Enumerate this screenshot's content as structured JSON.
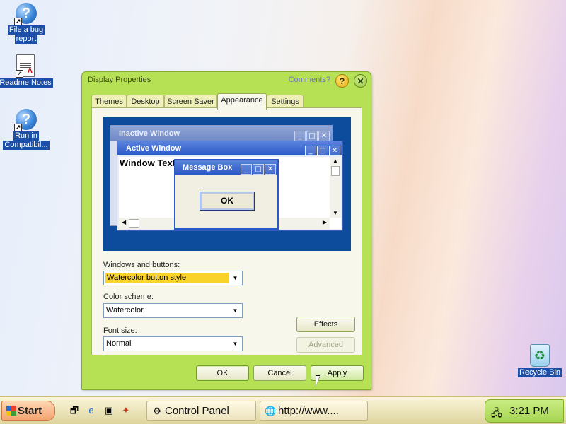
{
  "desktop": {
    "icons": [
      {
        "label_line1": "File a bug",
        "label_line2": "report",
        "icon": "help-icon"
      },
      {
        "label": "Readme Notes",
        "icon": "document-icon"
      },
      {
        "label_line1": "Run in",
        "label_line2": "Compatibil...",
        "icon": "help-icon"
      },
      {
        "label": "Recycle Bin",
        "icon": "recycle-bin-icon"
      }
    ]
  },
  "window": {
    "title": "Display Properties",
    "comments_link": "Comments?",
    "help_glyph": "?",
    "close_glyph": "✕",
    "tabs": [
      "Themes",
      "Desktop",
      "Screen Saver",
      "Appearance",
      "Settings"
    ],
    "active_tab": "Appearance",
    "preview": {
      "inactive_title": "Inactive Window",
      "active_title": "Active Window",
      "window_text": "Window Text",
      "message_box_title": "Message Box",
      "message_ok": "OK"
    },
    "windows_buttons": {
      "label": "Windows and buttons:",
      "value": "Watercolor button style"
    },
    "color_scheme": {
      "label": "Color scheme:",
      "value": "Watercolor"
    },
    "font_size": {
      "label": "Font size:",
      "value": "Normal"
    },
    "effects_button": "Effects",
    "advanced_button": "Advanced",
    "ok_button": "OK",
    "cancel_button": "Cancel",
    "apply_button": "Apply"
  },
  "taskbar": {
    "start_label": "Start",
    "tasks": [
      "Control Panel",
      "http://www...."
    ],
    "clock": "3:21 PM"
  },
  "colors": {
    "window_frame": "#b7e155",
    "preview_bg": "#0d4c9c",
    "highlight": "#f8d329",
    "tray": "#a6d552"
  }
}
